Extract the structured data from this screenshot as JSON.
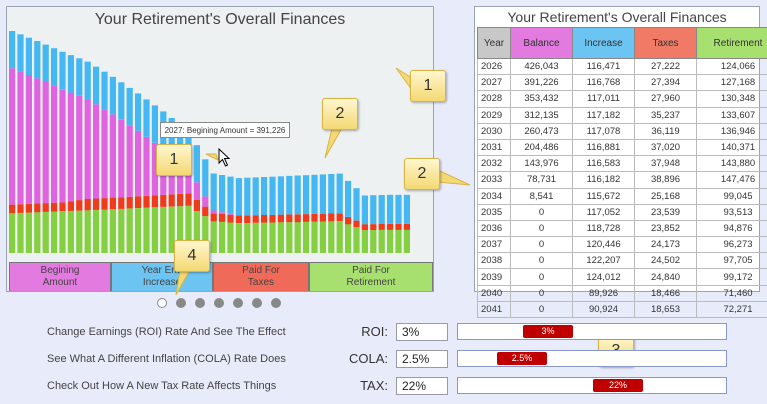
{
  "chart": {
    "title": "Your Retirement's Overall Finances",
    "tooltip": "2027: Begining Amount = 391,226",
    "colors": {
      "balance": "#e064e0",
      "increase": "#45b8f4",
      "taxes": "#f03a1c",
      "retirement": "#84d040"
    },
    "legend": [
      {
        "label": "Begining\nAmount",
        "color": "#e27ae0"
      },
      {
        "label": "Year End\nIncrease",
        "color": "#6cc4f2"
      },
      {
        "label": "Paid For\nTaxes",
        "color": "#f06a5a"
      },
      {
        "label": "Paid For\nRetirement",
        "color": "#a8e070"
      }
    ]
  },
  "chart_data": {
    "type": "bar",
    "title": "Your Retirement's Overall Finances",
    "stacked": true,
    "categories": [
      "2026",
      "2027",
      "2028",
      "2029",
      "2030",
      "2031",
      "2032",
      "2033",
      "2034",
      "2035",
      "2036",
      "2037",
      "2038",
      "2039",
      "2040",
      "2041"
    ],
    "series": [
      {
        "name": "Begining Amount",
        "values": [
          426043,
          391226,
          353432,
          312135,
          260473,
          204486,
          143976,
          78731,
          8541,
          0,
          0,
          0,
          0,
          0,
          0,
          0
        ]
      },
      {
        "name": "Year End Increase",
        "values": [
          116471,
          116768,
          117011,
          117182,
          117078,
          116881,
          116583,
          116182,
          115672,
          117052,
          118728,
          120446,
          122207,
          124012,
          89926,
          90924
        ]
      },
      {
        "name": "Paid For Taxes",
        "values": [
          27222,
          27394,
          27960,
          35237,
          36119,
          37020,
          37948,
          38896,
          25168,
          23539,
          23852,
          24173,
          24502,
          24840,
          18466,
          18653
        ]
      },
      {
        "name": "Paid For Retirement",
        "values": [
          124066,
          127168,
          130348,
          133607,
          136946,
          140371,
          143880,
          147476,
          99045,
          93513,
          94876,
          96273,
          97705,
          99172,
          71460,
          72271
        ]
      }
    ]
  },
  "pager": {
    "count": 7,
    "active": 0
  },
  "table": {
    "title": "Your Retirement's Overall Finances",
    "headers": [
      "Year",
      "Balance",
      "Increase",
      "Taxes",
      "Retirement"
    ],
    "header_colors": [
      "#c8c8c8",
      "#e27ae0",
      "#6cc4f2",
      "#f07a66",
      "#a8e070"
    ],
    "rows": [
      [
        "2026",
        "426,043",
        "116,471",
        "27,222",
        "124,066"
      ],
      [
        "2027",
        "391,226",
        "116,768",
        "27,394",
        "127,168"
      ],
      [
        "2028",
        "353,432",
        "117,011",
        "27,960",
        "130,348"
      ],
      [
        "2029",
        "312,135",
        "117,182",
        "35,237",
        "133,607"
      ],
      [
        "2030",
        "260,473",
        "117,078",
        "36,119",
        "136,946"
      ],
      [
        "2031",
        "204,486",
        "116,881",
        "37,020",
        "140,371"
      ],
      [
        "2032",
        "143,976",
        "116,583",
        "37,948",
        "143,880"
      ],
      [
        "2033",
        "78,731",
        "116,182",
        "38,896",
        "147,476"
      ],
      [
        "2034",
        "8,541",
        "115,672",
        "25,168",
        "99,045"
      ],
      [
        "2035",
        "0",
        "117,052",
        "23,539",
        "93,513"
      ],
      [
        "2036",
        "0",
        "118,728",
        "23,852",
        "94,876"
      ],
      [
        "2037",
        "0",
        "120,446",
        "24,173",
        "96,273"
      ],
      [
        "2038",
        "0",
        "122,207",
        "24,502",
        "97,705"
      ],
      [
        "2039",
        "0",
        "124,012",
        "24,840",
        "99,172"
      ],
      [
        "2040",
        "0",
        "89,926",
        "18,466",
        "71,460"
      ],
      [
        "2041",
        "0",
        "90,924",
        "18,653",
        "72,271"
      ]
    ]
  },
  "callouts": [
    "1",
    "2",
    "1",
    "2",
    "4",
    "3"
  ],
  "controls": [
    {
      "label": "Change Earnings (ROI) Rate And See The Effect",
      "name": "ROI:",
      "value": "3%",
      "thumb": "3%",
      "level": 0.3
    },
    {
      "label": "See What A Different Inflation (COLA) Rate Does",
      "name": "COLA:",
      "value": "2.5%",
      "thumb": "2.5%",
      "level": 0.18
    },
    {
      "label": "Check Out How A New Tax Rate Affects Things",
      "name": "TAX:",
      "value": "22%",
      "thumb": "22%",
      "level": 0.62
    }
  ]
}
